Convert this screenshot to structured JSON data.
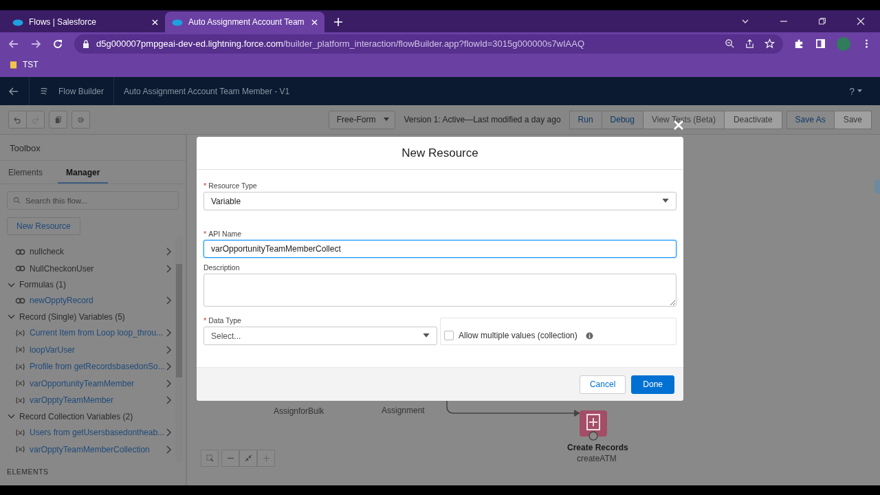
{
  "browser": {
    "tabs": [
      {
        "title": "Flows | Salesforce",
        "selected": false
      },
      {
        "title": "Auto Assignment Account Team",
        "selected": true
      }
    ],
    "url": {
      "domain": "d5g000007pmpgeai-dev-ed.lightning.force.com",
      "path": "/builder_platform_interaction/flowBuilder.app?flowId=3015g000000s7wIAAQ"
    },
    "bookmarks": [
      "TST"
    ]
  },
  "header": {
    "app_name": "Flow Builder",
    "flow_title": "Auto Assignment Account Team Member - V1",
    "help": "?"
  },
  "toolbar": {
    "layout": "Free-Form",
    "status": "Version 1: Active—Last modified a day ago",
    "buttons": [
      {
        "label": "Run",
        "disabled": false
      },
      {
        "label": "Debug",
        "disabled": false
      },
      {
        "label": "View Tests (Beta)",
        "disabled": true
      },
      {
        "label": "Deactivate",
        "disabled": true
      },
      {
        "label": "Save As",
        "disabled": false
      },
      {
        "label": "Save",
        "disabled": true
      }
    ]
  },
  "toolbox": {
    "title": "Toolbox",
    "tabs": [
      {
        "label": "Elements",
        "selected": false
      },
      {
        "label": "Manager",
        "selected": true
      }
    ],
    "search": {
      "placeholder": "Search this flow..."
    },
    "new_resource": "New Resource",
    "tree": [
      {
        "kind": "formula",
        "label": "nullcheck",
        "linked": false
      },
      {
        "kind": "formula",
        "label": "NullCheckonUser",
        "linked": false
      },
      {
        "kind": "group",
        "label": "Formulas (1)",
        "expanded": true,
        "children": [
          {
            "kind": "formula",
            "label": "newOpptyRecord",
            "linked": true
          }
        ]
      },
      {
        "kind": "group",
        "label": "Record (Single) Variables (5)",
        "expanded": true,
        "children": [
          {
            "kind": "variable",
            "label": "Current Item from Loop loop_throu...",
            "linked": true
          },
          {
            "kind": "variable",
            "label": "loopVarUser",
            "linked": true
          },
          {
            "kind": "variable",
            "label": "Profile from getRecordsbasedonSo...",
            "linked": true
          },
          {
            "kind": "variable",
            "label": "varOpportunityTeamMember",
            "linked": true
          },
          {
            "kind": "variable",
            "label": "varOpptyTeamMember",
            "linked": true
          }
        ]
      },
      {
        "kind": "group",
        "label": "Record Collection Variables (2)",
        "expanded": true,
        "children": [
          {
            "kind": "variable",
            "label": "Users from getUsersbasedontheab...",
            "linked": true
          },
          {
            "kind": "variable",
            "label": "varOpptyTeamMemberCollection",
            "linked": true
          }
        ]
      }
    ],
    "section_heading": "ELEMENTS"
  },
  "canvas": {
    "node_labels": [
      "AssignforBulk",
      "Assignment"
    ],
    "create_node": {
      "title": "Create Records",
      "api_name": "createATM"
    }
  },
  "modal": {
    "title": "New Resource",
    "required_mark": "*",
    "resource_type": {
      "label": "Resource Type",
      "required": true,
      "value": "Variable"
    },
    "api_name": {
      "label": "API Name",
      "required": true,
      "value": "varOpportunityTeamMemberCollect"
    },
    "description": {
      "label": "Description",
      "required": false
    },
    "data_type": {
      "label": "Data Type",
      "required": true,
      "placeholder": "Select..."
    },
    "allow_multiple": {
      "label": "Allow multiple values (collection)",
      "checked": false
    },
    "buttons": [
      {
        "label": "Cancel",
        "kind": "neutral"
      },
      {
        "label": "Done",
        "kind": "brand"
      }
    ]
  }
}
